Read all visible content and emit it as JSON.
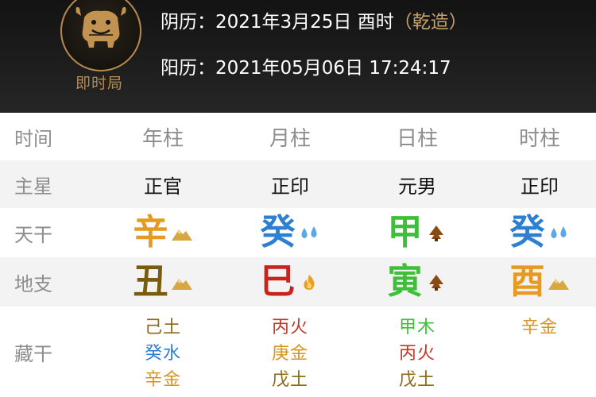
{
  "header": {
    "badge_label": "即时局",
    "lunar_label": "阴历：",
    "lunar_value": "2021年3月25日 酉时",
    "lunar_tag": "（乾造）",
    "solar_label": "阳历：",
    "solar_value": "2021年05月06日 17:24:17"
  },
  "table": {
    "row_labels": {
      "time": "时间",
      "main_star": "主星",
      "heavenly_stem": "天干",
      "earthly_branch": "地支",
      "hidden_stem": "藏干"
    },
    "columns": [
      {
        "header": "年柱",
        "main_star": "正官",
        "stem": "辛",
        "stem_color": "#e69a1f",
        "stem_icon": "mountain-icon",
        "branch": "丑",
        "branch_color": "#7a5c10",
        "branch_icon": "mountain-icon",
        "hidden": [
          {
            "text": "己土",
            "color": "#8a6a16"
          },
          {
            "text": "癸水",
            "color": "#2d7fd2"
          },
          {
            "text": "辛金",
            "color": "#d8951d"
          }
        ]
      },
      {
        "header": "月柱",
        "main_star": "正印",
        "stem": "癸",
        "stem_color": "#2d7fd2",
        "stem_icon": "water-drops-icon",
        "branch": "巳",
        "branch_color": "#c8231c",
        "branch_icon": "fire-icon",
        "hidden": [
          {
            "text": "丙火",
            "color": "#c0392b"
          },
          {
            "text": "庚金",
            "color": "#d8951d"
          },
          {
            "text": "戊土",
            "color": "#8a6a16"
          }
        ]
      },
      {
        "header": "日柱",
        "main_star": "元男",
        "stem": "甲",
        "stem_color": "#3fbe3a",
        "stem_icon": "tree-icon",
        "branch": "寅",
        "branch_color": "#3fbe3a",
        "branch_icon": "tree-icon",
        "hidden": [
          {
            "text": "甲木",
            "color": "#3fbe3a"
          },
          {
            "text": "丙火",
            "color": "#c0392b"
          },
          {
            "text": "戊土",
            "color": "#8a6a16"
          }
        ]
      },
      {
        "header": "时柱",
        "main_star": "正印",
        "stem": "癸",
        "stem_color": "#2d7fd2",
        "stem_icon": "water-drops-icon",
        "branch": "酉",
        "branch_color": "#e69a1f",
        "branch_icon": "mountain-icon",
        "hidden": [
          {
            "text": "辛金",
            "color": "#d8951d"
          }
        ]
      }
    ]
  },
  "colors": {
    "header_bg": "#1a1a1a",
    "gold_accent": "#b88a4e",
    "label_gray": "#8e8e8e",
    "row_shade": "#f3f3f3"
  }
}
